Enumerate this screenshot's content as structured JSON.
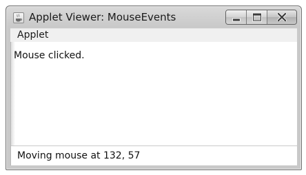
{
  "window": {
    "title": "Applet Viewer: MouseEvents",
    "app_icon": "java-coffee-cup-icon",
    "caption_buttons": {
      "minimize_icon": "minimize-icon",
      "maximize_icon": "maximize-icon",
      "close_icon": "close-icon"
    }
  },
  "menubar": {
    "items": [
      {
        "label": "Applet"
      }
    ]
  },
  "applet": {
    "message": "Mouse clicked."
  },
  "status_bar": {
    "text": "Moving mouse at 132, 57"
  }
}
